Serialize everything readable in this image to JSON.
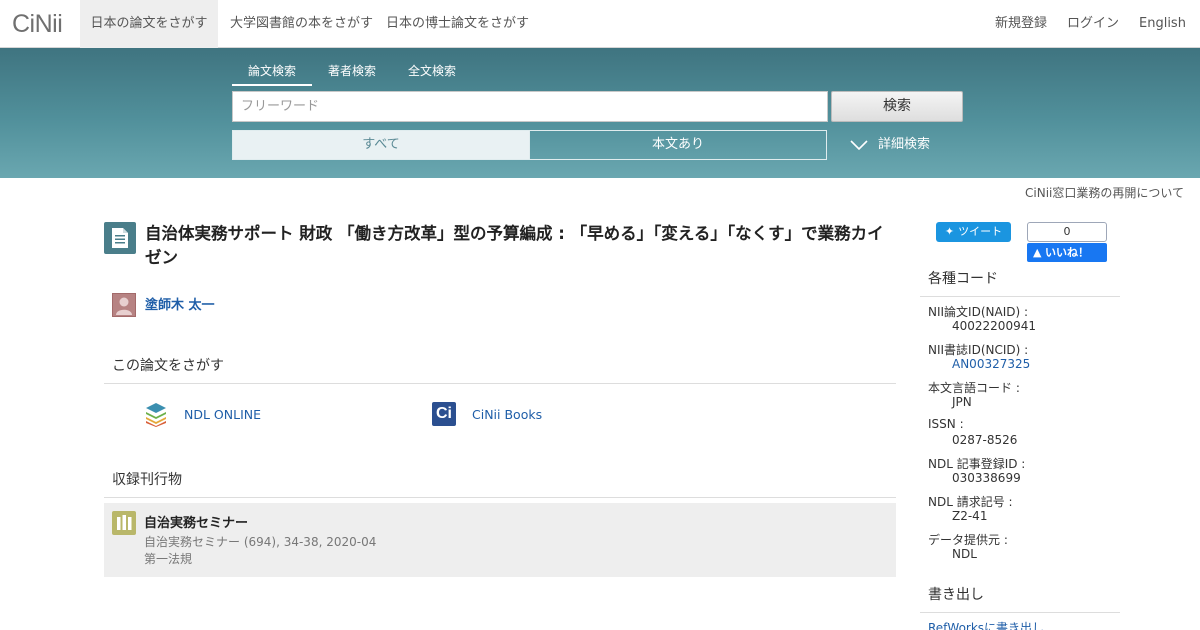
{
  "header": {
    "logo": "CiNii",
    "tabs": [
      {
        "label": "日本の論文をさがす"
      },
      {
        "label": "大学図書館の本をさがす"
      },
      {
        "label": "日本の博士論文をさがす"
      }
    ],
    "links": {
      "register": "新規登録",
      "login": "ログイン",
      "language": "English"
    }
  },
  "search": {
    "tabs": [
      {
        "label": "論文検索"
      },
      {
        "label": "著者検索"
      },
      {
        "label": "全文検索"
      }
    ],
    "placeholder": "フリーワード",
    "button": "検索",
    "filter_all": "すべて",
    "filter_fulltext": "本文あり",
    "advanced": "詳細検索"
  },
  "notice": "CiNii窓口業務の再開について",
  "article": {
    "title": "自治体実務サポート 財政 「働き方改革」型の予算編成 : 「早める」「変える」「なくす」で業務カイゼン",
    "author": "塗師木 太一"
  },
  "find": {
    "heading": "この論文をさがす",
    "ndl": "NDL ONLINE",
    "cinii_books": "CiNii Books"
  },
  "publication": {
    "heading": "収録刊行物",
    "title": "自治実務セミナー",
    "detail": "自治実務セミナー (694), 34-38, 2020-04",
    "publisher": "第一法規"
  },
  "social": {
    "tweet": "ツイート",
    "like_count": "0",
    "like": "いいね！"
  },
  "codes": {
    "heading": "各種コード",
    "items": [
      {
        "label": "NII論文ID(NAID) :",
        "value": "40022200941"
      },
      {
        "label": "NII書誌ID(NCID) :",
        "value": "AN00327325"
      },
      {
        "label": "本文言語コード :",
        "value": "JPN"
      },
      {
        "label": "ISSN :",
        "value": "0287-8526"
      },
      {
        "label": "NDL 記事登録ID :",
        "value": "030338699"
      },
      {
        "label": "NDL 請求記号 :",
        "value": "Z2-41"
      },
      {
        "label": "データ提供元 :",
        "value": "NDL"
      }
    ]
  },
  "export": {
    "heading": "書き出し",
    "refworks": "RefWorksに書き出し"
  }
}
